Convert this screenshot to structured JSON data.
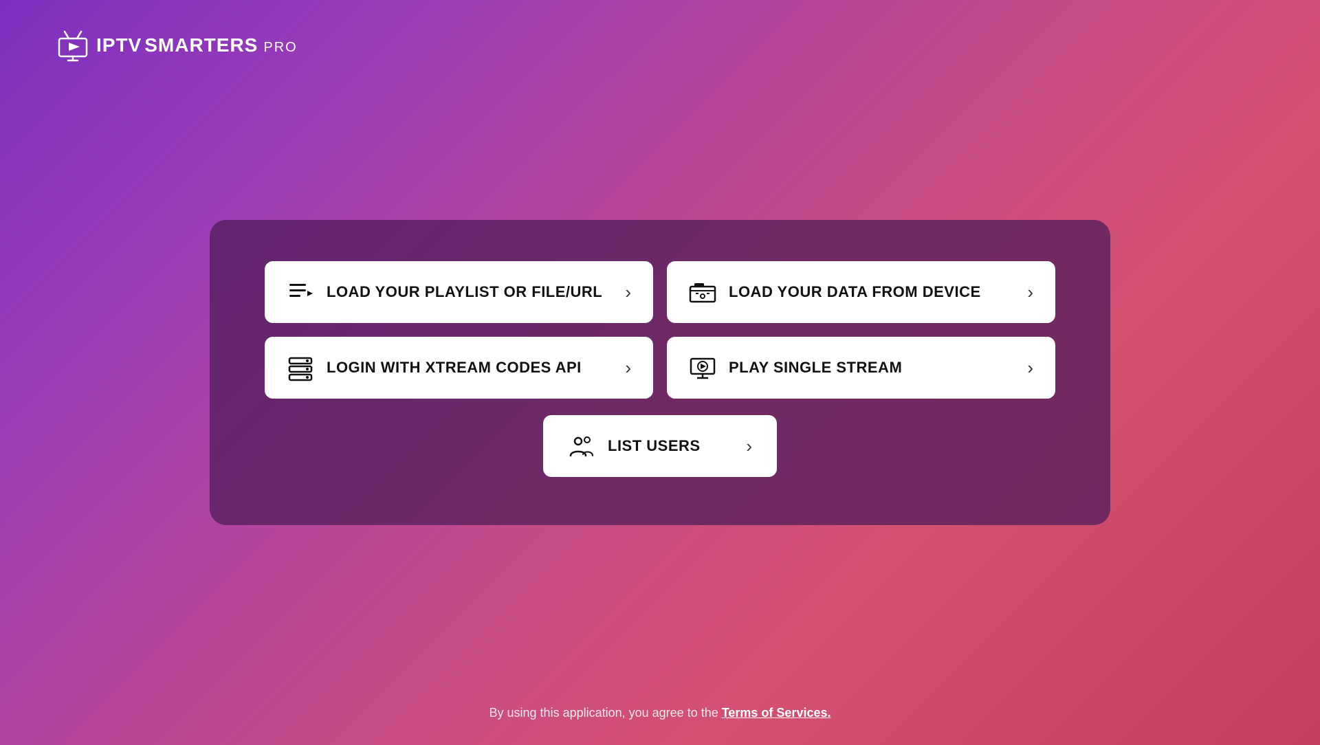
{
  "logo": {
    "iptv": "IPTV",
    "smarters": "SMARTERS",
    "pro": "PRO"
  },
  "menu": {
    "buttons": [
      {
        "id": "load-playlist",
        "label": "LOAD YOUR PLAYLIST OR FILE/URL",
        "icon": "playlist-icon"
      },
      {
        "id": "load-device",
        "label": "LOAD YOUR DATA FROM DEVICE",
        "icon": "device-icon"
      },
      {
        "id": "xtream-codes",
        "label": "LOGIN WITH XTREAM CODES API",
        "icon": "api-icon"
      },
      {
        "id": "single-stream",
        "label": "PLAY SINGLE STREAM",
        "icon": "stream-icon"
      }
    ],
    "list_users": {
      "label": "LIST USERS",
      "icon": "users-icon"
    }
  },
  "footer": {
    "text_before_link": "By using this application, you agree to the ",
    "link_label": "Terms of Services."
  }
}
